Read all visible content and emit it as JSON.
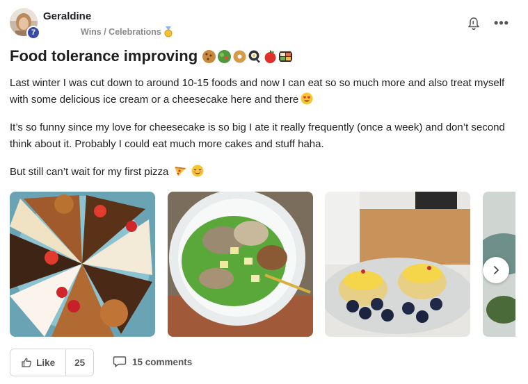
{
  "post": {
    "author": "Geraldine",
    "level": "7",
    "category": "Wins / Celebrations",
    "title": "Food tolerance improving",
    "title_emojis": [
      "cookie-icon",
      "salad-icon",
      "bagel-icon",
      "frying-pan-icon",
      "apple-icon",
      "bento-icon"
    ],
    "paragraphs": [
      "Last winter I was cut down to around 10-15 foods and now I can eat so so much more and also treat myself with some delicious ice cream or a cheesecake here and there",
      "It’s so funny since my love for cheesecake is so big I ate it really frequently (once a week) and don’t second think about it. Probably I could eat much more cakes and stuff haha.",
      "But still can’t wait for my first pizza"
    ],
    "photos": [
      "cakes-photo",
      "salad-photo",
      "eggs-blueberries-photo",
      "partial-photo"
    ]
  },
  "footer": {
    "like_label": "Like",
    "like_count": "25",
    "comments_label": "15 comments"
  },
  "colors": {
    "level_badge": "#3a4aa8",
    "text": "#202124",
    "muted": "#8a8a8a"
  }
}
